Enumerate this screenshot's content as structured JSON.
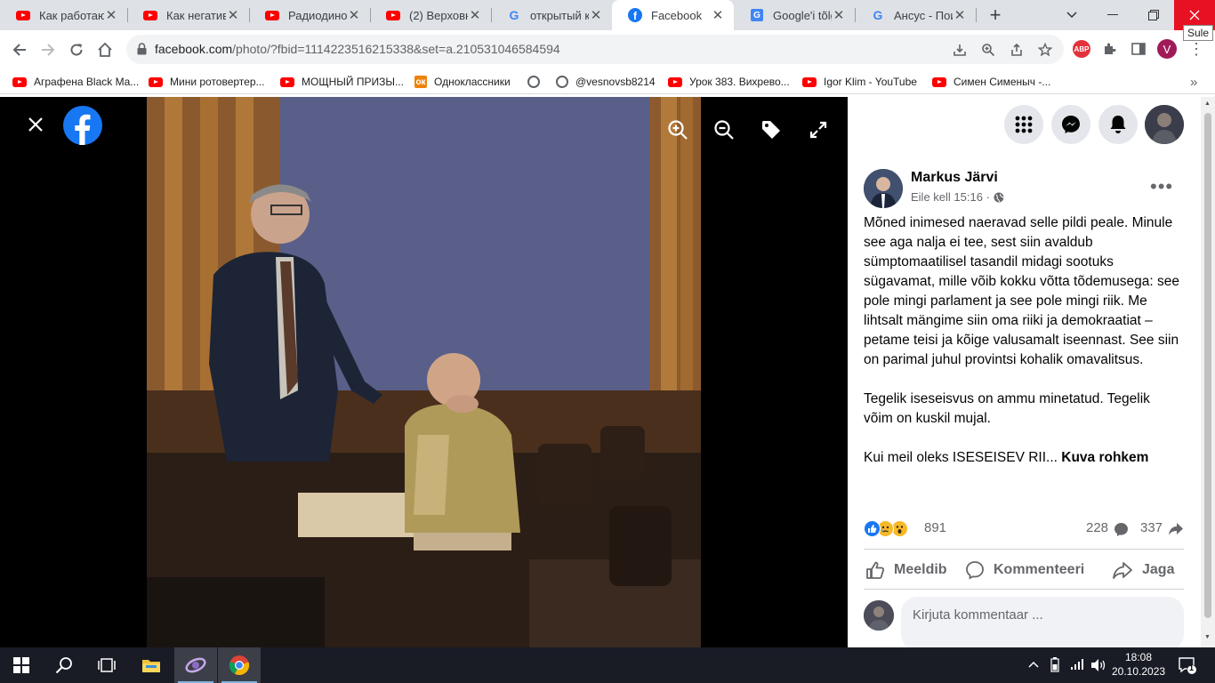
{
  "browser": {
    "tabs": [
      {
        "icon": "youtube-icon",
        "label": "Как работаю",
        "active": false
      },
      {
        "icon": "youtube-icon",
        "label": "Как негатив",
        "active": false
      },
      {
        "icon": "youtube-icon",
        "label": "Радиодиноз",
        "active": false
      },
      {
        "icon": "youtube-icon",
        "label": "(2) Верховна",
        "active": false
      },
      {
        "icon": "google-icon",
        "label": "открытый ко",
        "active": false
      },
      {
        "icon": "facebook-icon",
        "label": "Facebook",
        "active": true
      },
      {
        "icon": "google-translate-icon",
        "label": "Google'i tõlg",
        "active": false
      },
      {
        "icon": "google-icon",
        "label": "Ансус - Пои",
        "active": false
      }
    ],
    "new_tab": "+",
    "close_tooltip": "Sule",
    "url_host": "facebook.com",
    "url_path": "/photo/?fbid=1114223516215338&set=a.210531046584594",
    "profile_initial": "V",
    "abp_label": "ABP",
    "bookmarks": [
      {
        "icon": "youtube-icon",
        "label": "Аграфена Black Ma..."
      },
      {
        "icon": "youtube-icon",
        "label": "Мини ротовертер..."
      },
      {
        "icon": "youtube-icon",
        "label": "МОЩНЫЙ ПРИЗЫ..."
      },
      {
        "icon": "odnoklassniki-icon",
        "label": "Одноклассники"
      },
      {
        "icon": "globe-icon",
        "label": ""
      },
      {
        "icon": "globe-icon",
        "label": "@vesnovsb8214"
      },
      {
        "icon": "youtube-icon",
        "label": "Урок 383. Вихрево..."
      },
      {
        "icon": "youtube-icon",
        "label": "Igor Klim - YouTube"
      },
      {
        "icon": "youtube-icon",
        "label": "Симен Сименыч -..."
      }
    ],
    "bookmarks_overflow": "»"
  },
  "post": {
    "author": "Markus Järvi",
    "time": "Eile kell 15:16 ·",
    "paragraphs": [
      "Mõned inimesed naeravad selle pildi peale. Minule see aga nalja ei tee, sest siin avaldub sümptomaatilisel tasandil midagi sootuks sügavamat, mille võib kokku võtta tõdemusega: see pole mingi parlament ja see pole mingi riik. Me lihtsalt mängime siin oma riiki ja demokraatiat – petame teisi ja kõige valusamalt iseennast. See siin on parimal juhul provintsi kohalik omavalitsus.",
      "Tegelik iseseisvus on ammu minetatud. Tegelik võim on kuskil mujal."
    ],
    "truncated_text": "Kui meil oleks ISESEISEV RII... ",
    "see_more": "Kuva rohkem",
    "reaction_count": "891",
    "comment_count": "228",
    "share_count": "337",
    "actions": {
      "like": "Meeldib",
      "comment": "Kommenteeri",
      "share": "Jaga"
    },
    "comment_placeholder": "Kirjuta kommentaar ..."
  },
  "taskbar": {
    "time": "18:08",
    "date": "20.10.2023",
    "notifications": "1"
  }
}
